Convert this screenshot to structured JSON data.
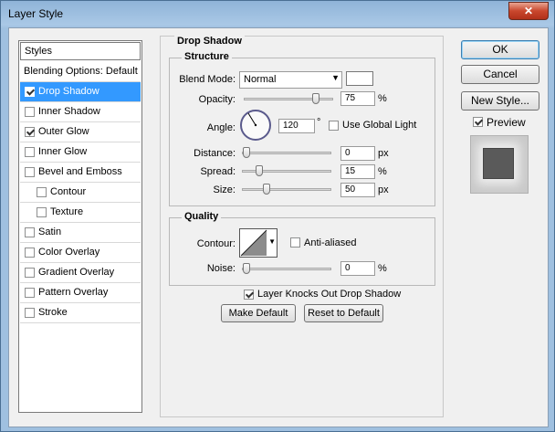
{
  "window": {
    "title": "Layer Style",
    "close_glyph": "✕"
  },
  "styles_list": {
    "header": "Styles",
    "items": [
      {
        "label": "Blending Options: Default",
        "checkbox": false,
        "checked": false,
        "selected": false,
        "indent": false
      },
      {
        "label": "Drop Shadow",
        "checkbox": true,
        "checked": true,
        "selected": true,
        "indent": false
      },
      {
        "label": "Inner Shadow",
        "checkbox": true,
        "checked": false,
        "selected": false,
        "indent": false
      },
      {
        "label": "Outer Glow",
        "checkbox": true,
        "checked": true,
        "selected": false,
        "indent": false
      },
      {
        "label": "Inner Glow",
        "checkbox": true,
        "checked": false,
        "selected": false,
        "indent": false
      },
      {
        "label": "Bevel and Emboss",
        "checkbox": true,
        "checked": false,
        "selected": false,
        "indent": false
      },
      {
        "label": "Contour",
        "checkbox": true,
        "checked": false,
        "selected": false,
        "indent": true
      },
      {
        "label": "Texture",
        "checkbox": true,
        "checked": false,
        "selected": false,
        "indent": true
      },
      {
        "label": "Satin",
        "checkbox": true,
        "checked": false,
        "selected": false,
        "indent": false
      },
      {
        "label": "Color Overlay",
        "checkbox": true,
        "checked": false,
        "selected": false,
        "indent": false
      },
      {
        "label": "Gradient Overlay",
        "checkbox": true,
        "checked": false,
        "selected": false,
        "indent": false
      },
      {
        "label": "Pattern Overlay",
        "checkbox": true,
        "checked": false,
        "selected": false,
        "indent": false
      },
      {
        "label": "Stroke",
        "checkbox": true,
        "checked": false,
        "selected": false,
        "indent": false
      }
    ]
  },
  "drop_shadow": {
    "section_title": "Drop Shadow",
    "structure": {
      "title": "Structure",
      "blend_mode_label": "Blend Mode:",
      "blend_mode_value": "Normal",
      "shadow_color": "#ffffff",
      "opacity_label": "Opacity:",
      "opacity_value": "75",
      "opacity_unit": "%",
      "angle_label": "Angle:",
      "angle_value": "120",
      "angle_unit": "°",
      "use_global_light_label": "Use Global Light",
      "use_global_light": false,
      "distance_label": "Distance:",
      "distance_value": "0",
      "distance_unit": "px",
      "spread_label": "Spread:",
      "spread_value": "15",
      "spread_unit": "%",
      "size_label": "Size:",
      "size_value": "50",
      "size_unit": "px"
    },
    "quality": {
      "title": "Quality",
      "contour_label": "Contour:",
      "anti_aliased_label": "Anti-aliased",
      "anti_aliased": false,
      "noise_label": "Noise:",
      "noise_value": "0",
      "noise_unit": "%"
    },
    "layer_knocks_out_label": "Layer Knocks Out Drop Shadow",
    "layer_knocks_out": true,
    "make_default_label": "Make Default",
    "reset_default_label": "Reset to Default"
  },
  "actions": {
    "ok_label": "OK",
    "cancel_label": "Cancel",
    "new_style_label": "New Style...",
    "preview_label": "Preview",
    "preview_checked": true
  }
}
